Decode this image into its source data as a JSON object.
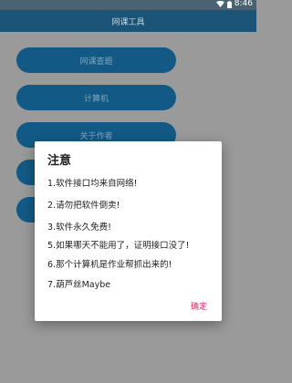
{
  "status_bar": {
    "time": "8:46",
    "icons": [
      "wifi-icon",
      "battery-icon"
    ]
  },
  "app_bar": {
    "title": "网课工具"
  },
  "menu": [
    {
      "label": "网课查题"
    },
    {
      "label": "计算机"
    },
    {
      "label": "关于作者"
    },
    {
      "label": ""
    },
    {
      "label": ""
    }
  ],
  "dialog": {
    "title": "注意",
    "lines": [
      "1.软件接口均来自网络!",
      "2.请勿把软件倒卖!",
      "3.软件永久免费!",
      "5.如果哪天不能用了，证明接口没了!",
      "6.那个计算机是作业帮抓出来的!",
      "7.葫芦丝Maybe"
    ],
    "ok_label": "确定"
  },
  "colors": {
    "primary_dark": "#1c5478",
    "button": "#125a85",
    "accent": "#e91e63",
    "scrim": "#9a9a9a"
  }
}
